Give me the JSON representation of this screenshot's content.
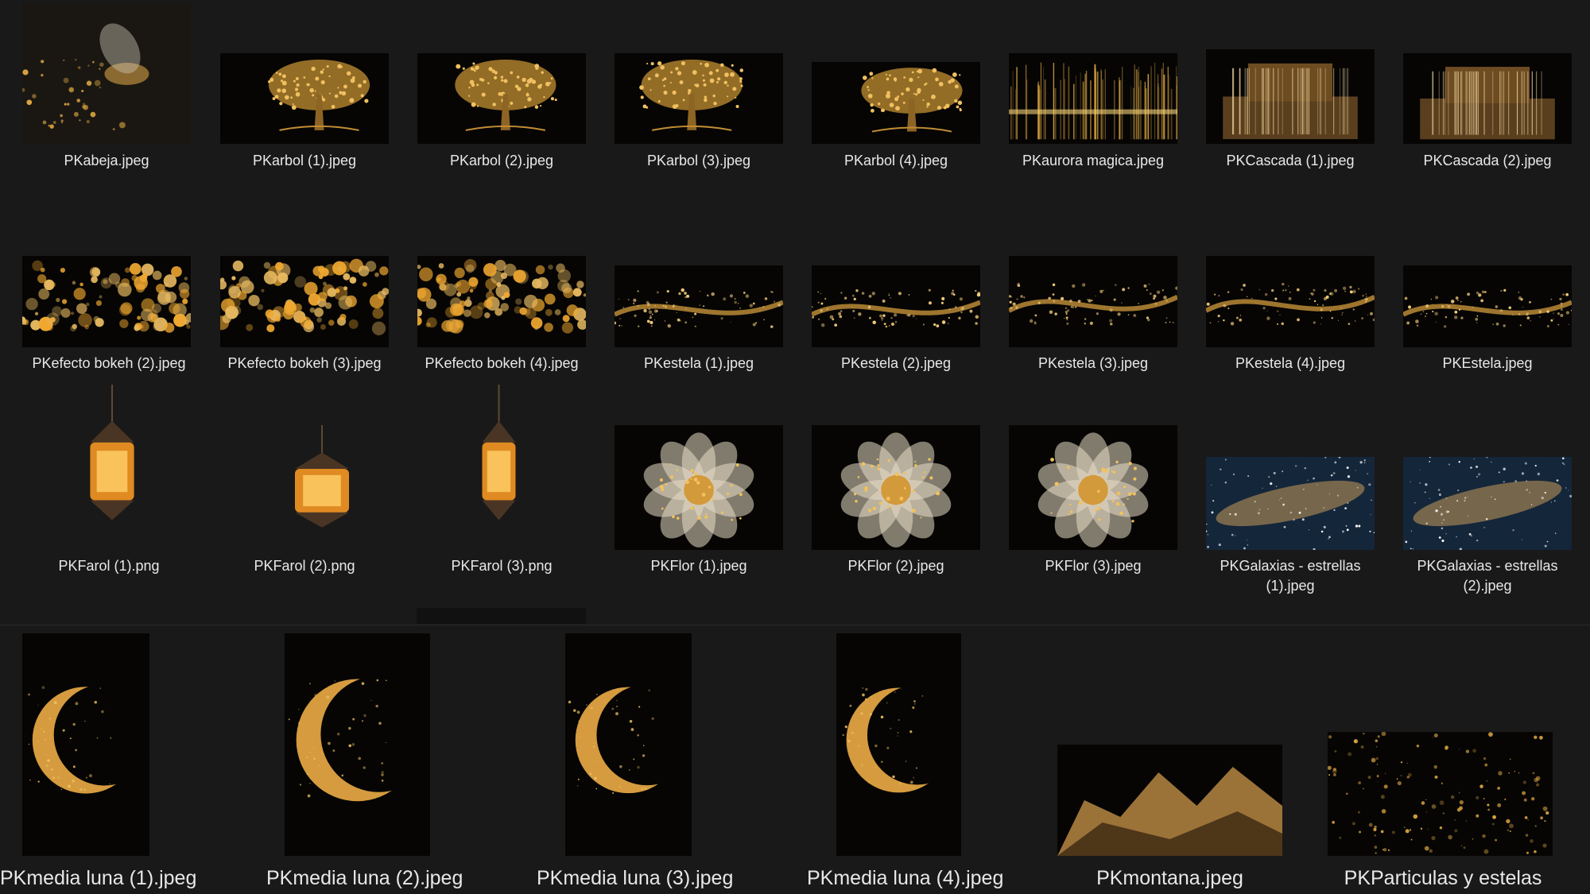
{
  "files": [
    {
      "name": "PKabeja.jpeg",
      "icon": "bee-image-icon"
    },
    {
      "name": "PKarbol (1).jpeg",
      "icon": "tree-image-icon"
    },
    {
      "name": "PKarbol (2).jpeg",
      "icon": "tree-image-icon"
    },
    {
      "name": "PKarbol (3).jpeg",
      "icon": "tree-image-icon"
    },
    {
      "name": "PKarbol (4).jpeg",
      "icon": "tree-image-icon"
    },
    {
      "name": "PKaurora magica.jpeg",
      "icon": "aurora-image-icon"
    },
    {
      "name": "PKCascada (1).jpeg",
      "icon": "waterfall-image-icon"
    },
    {
      "name": "PKCascada (2).jpeg",
      "icon": "waterfall-image-icon"
    },
    {
      "name": "PKefecto bokeh (2).jpeg",
      "icon": "bokeh-image-icon"
    },
    {
      "name": "PKefecto bokeh (3).jpeg",
      "icon": "bokeh-image-icon"
    },
    {
      "name": "PKefecto bokeh (4).jpeg",
      "icon": "bokeh-image-icon"
    },
    {
      "name": "PKestela (1).jpeg",
      "icon": "trail-image-icon"
    },
    {
      "name": "PKestela (2).jpeg",
      "icon": "trail-image-icon"
    },
    {
      "name": "PKestela (3).jpeg",
      "icon": "trail-image-icon"
    },
    {
      "name": "PKestela (4).jpeg",
      "icon": "trail-image-icon"
    },
    {
      "name": "PKEstela.jpeg",
      "icon": "trail-image-icon"
    },
    {
      "name": "PKFarol (1).png",
      "icon": "lantern-image-icon"
    },
    {
      "name": "PKFarol (2).png",
      "icon": "lantern-image-icon"
    },
    {
      "name": "PKFarol (3).png",
      "icon": "lantern-image-icon"
    },
    {
      "name": "PKFlor (1).jpeg",
      "icon": "flower-image-icon"
    },
    {
      "name": "PKFlor (2).jpeg",
      "icon": "flower-image-icon"
    },
    {
      "name": "PKFlor (3).jpeg",
      "icon": "flower-image-icon"
    },
    {
      "name": "PKGalaxias - estrellas (1).jpeg",
      "icon": "galaxy-image-icon"
    },
    {
      "name": "PKGalaxias - estrellas (2).jpeg",
      "icon": "galaxy-image-icon"
    },
    {
      "name": "PKmedia luna (1).jpeg",
      "icon": "moon-image-icon"
    },
    {
      "name": "PKmedia luna (2).jpeg",
      "icon": "moon-image-icon"
    },
    {
      "name": "PKmedia luna (3).jpeg",
      "icon": "moon-image-icon"
    },
    {
      "name": "PKmedia luna (4).jpeg",
      "icon": "moon-image-icon"
    },
    {
      "name": "PKmontana.jpeg",
      "icon": "mountain-image-icon"
    },
    {
      "name": "PKParticulas y estelas",
      "icon": "particles-image-icon"
    }
  ],
  "colors": {
    "background": "#191919",
    "label": "#e8e8e8",
    "gold": "#d9a441"
  }
}
